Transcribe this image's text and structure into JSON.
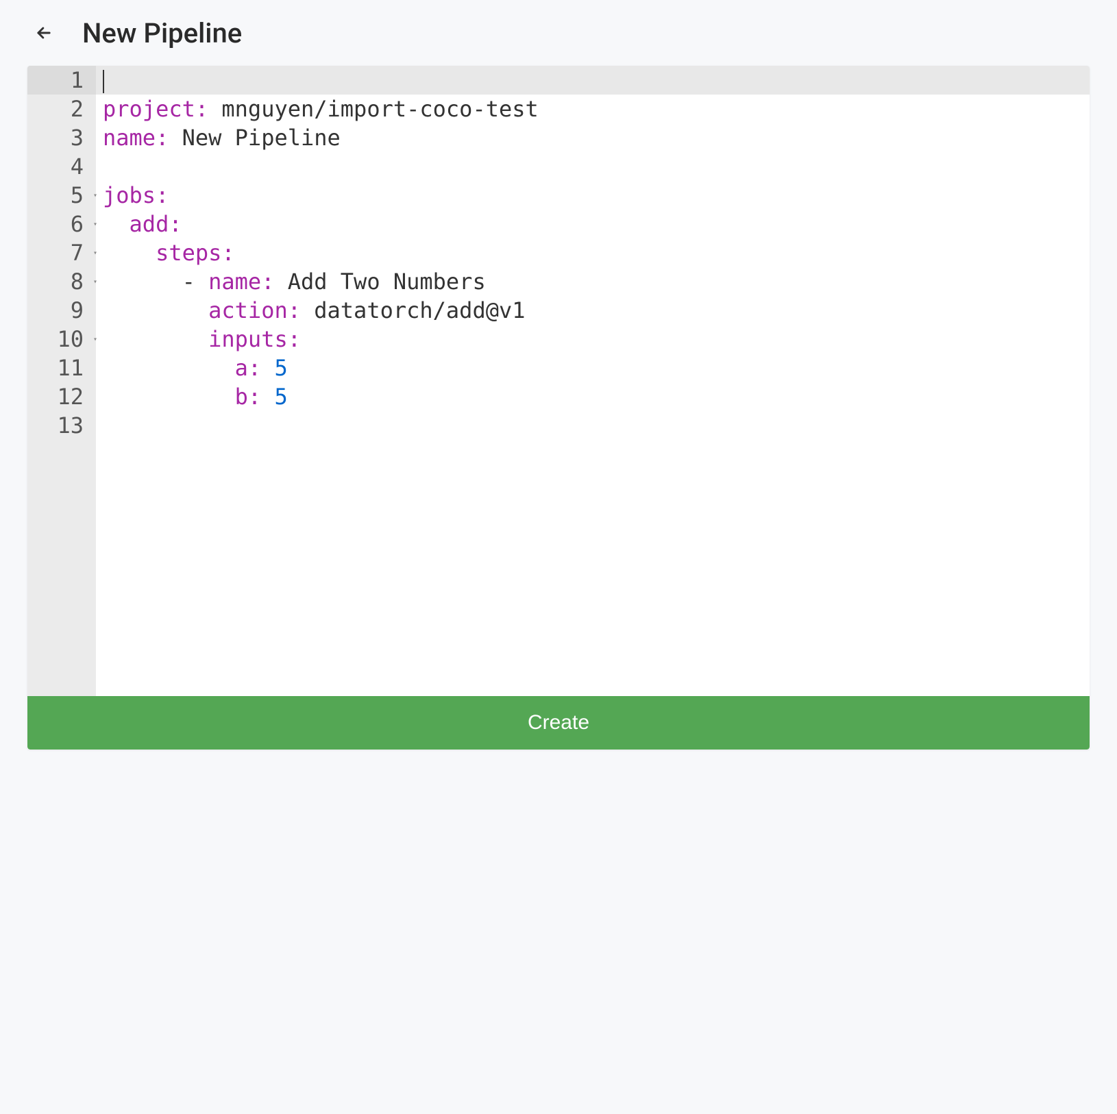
{
  "header": {
    "title": "New Pipeline"
  },
  "editor": {
    "lineCount": 13,
    "activeLine": 1,
    "foldLines": [
      5,
      6,
      7,
      8,
      10
    ],
    "code": {
      "project_key": "project:",
      "project_val": " mnguyen/import-coco-test",
      "name_key": "name:",
      "name_val": " New Pipeline",
      "jobs_key": "jobs:",
      "add_key": "add:",
      "steps_key": "steps:",
      "dash": "- ",
      "stepname_key": "name:",
      "stepname_val": " Add Two Numbers",
      "action_key": "action:",
      "action_val": " datatorch/add@v1",
      "inputs_key": "inputs:",
      "a_key": "a:",
      "a_val": " 5",
      "b_key": "b:",
      "b_val": " 5"
    }
  },
  "button": {
    "create_label": "Create"
  }
}
